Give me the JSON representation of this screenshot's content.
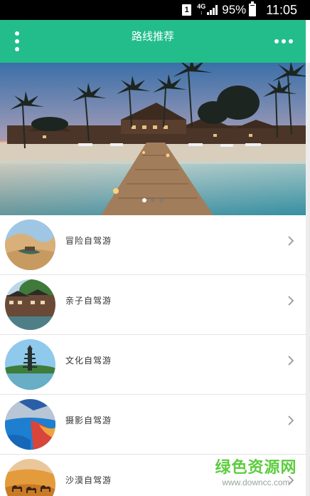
{
  "status_bar": {
    "sim": "1",
    "network": "4G",
    "battery": "95%",
    "time": "11:05"
  },
  "header": {
    "title": "路线推荐",
    "menu_icon": "kebab-vertical-icon",
    "more_icon": "more-horizontal-icon",
    "background": "#23bd8c"
  },
  "banner": {
    "slides": 3,
    "active_slide": 1
  },
  "routes": [
    {
      "label": "冒险自驾游",
      "image": "desert-oasis"
    },
    {
      "label": "亲子自驾游",
      "image": "ancient-town"
    },
    {
      "label": "文化自驾游",
      "image": "pagoda-lake"
    },
    {
      "label": "摄影自驾游",
      "image": "colorful-lake"
    },
    {
      "label": "沙漠自驾游",
      "image": "camel-desert"
    }
  ],
  "watermark": {
    "title": "绿色资源网",
    "url": "www.downcc.com"
  }
}
